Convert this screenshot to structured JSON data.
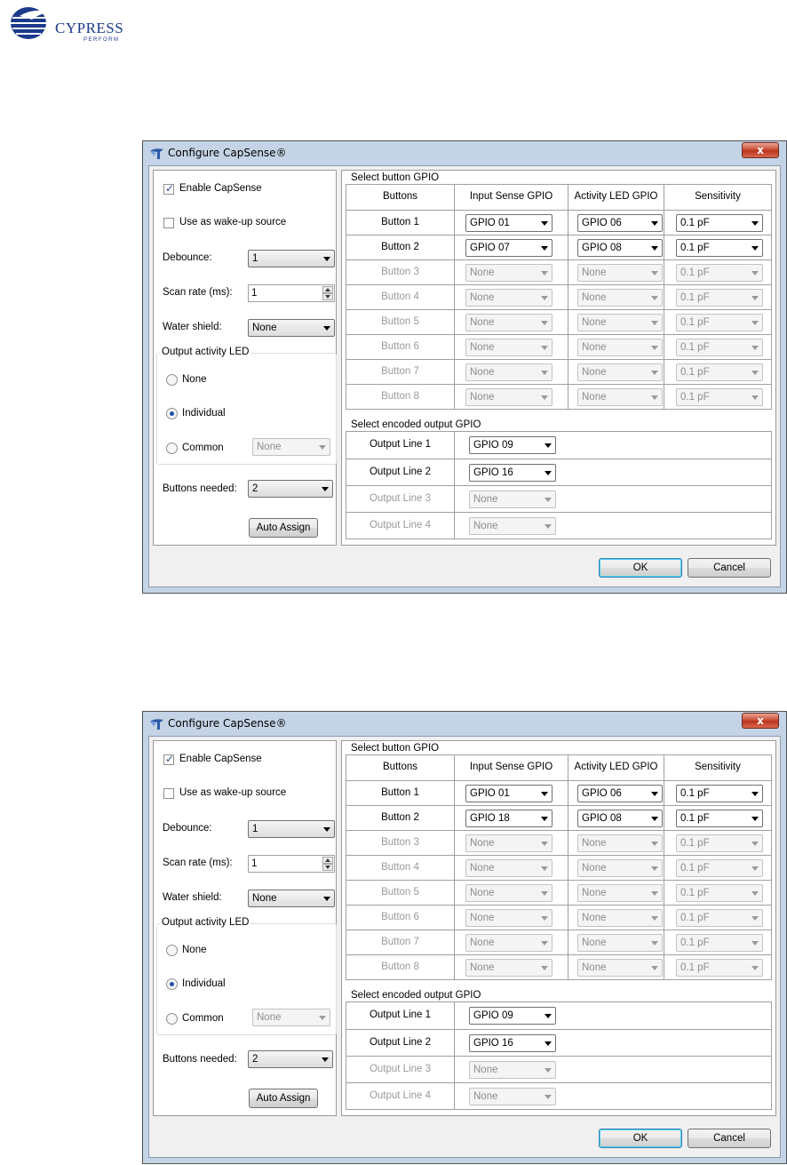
{
  "logo": {
    "name": "CYPRESS",
    "tagline": "PERFORM"
  },
  "dialogs": [
    {
      "title": "Configure CapSense®",
      "close_label": "x",
      "enable_capsense": {
        "label": "Enable CapSense",
        "checked": true
      },
      "wake_up": {
        "label": "Use as wake-up source",
        "checked": false
      },
      "debounce": {
        "label": "Debounce:",
        "value": "1"
      },
      "scan_rate": {
        "label": "Scan rate (ms):",
        "value": "1"
      },
      "water_shield": {
        "label": "Water shield:",
        "value": "None"
      },
      "output_led": {
        "title": "Output activity LED",
        "none_label": "None",
        "individual_label": "Individual",
        "common_label": "Common",
        "common_value": "None",
        "selected": "individual"
      },
      "buttons_needed": {
        "label": "Buttons needed:",
        "value": "2"
      },
      "auto_assign_label": "Auto Assign",
      "button_gpio": {
        "title": "Select button GPIO",
        "headers": [
          "Buttons",
          "Input Sense GPIO",
          "Activity LED GPIO",
          "Sensitivity"
        ],
        "rows": [
          {
            "name": "Button 1",
            "input": "GPIO 01",
            "led": "GPIO 06",
            "sens": "0.1 pF",
            "enabled": true
          },
          {
            "name": "Button 2",
            "input": "GPIO 07",
            "led": "GPIO 08",
            "sens": "0.1 pF",
            "enabled": true
          },
          {
            "name": "Button 3",
            "input": "None",
            "led": "None",
            "sens": "0.1 pF",
            "enabled": false
          },
          {
            "name": "Button 4",
            "input": "None",
            "led": "None",
            "sens": "0.1 pF",
            "enabled": false
          },
          {
            "name": "Button 5",
            "input": "None",
            "led": "None",
            "sens": "0.1 pF",
            "enabled": false
          },
          {
            "name": "Button 6",
            "input": "None",
            "led": "None",
            "sens": "0.1 pF",
            "enabled": false
          },
          {
            "name": "Button 7",
            "input": "None",
            "led": "None",
            "sens": "0.1 pF",
            "enabled": false
          },
          {
            "name": "Button 8",
            "input": "None",
            "led": "None",
            "sens": "0.1 pF",
            "enabled": false
          }
        ]
      },
      "encoded_output": {
        "title": "Select encoded output GPIO",
        "rows": [
          {
            "name": "Output Line 1",
            "value": "GPIO 09",
            "enabled": true
          },
          {
            "name": "Output Line 2",
            "value": "GPIO 16",
            "enabled": true
          },
          {
            "name": "Output Line 3",
            "value": "None",
            "enabled": false
          },
          {
            "name": "Output Line 4",
            "value": "None",
            "enabled": false
          }
        ]
      },
      "ok_label": "OK",
      "cancel_label": "Cancel"
    },
    {
      "title": "Configure CapSense®",
      "close_label": "x",
      "enable_capsense": {
        "label": "Enable CapSense",
        "checked": true
      },
      "wake_up": {
        "label": "Use as wake-up source",
        "checked": false
      },
      "debounce": {
        "label": "Debounce:",
        "value": "1"
      },
      "scan_rate": {
        "label": "Scan rate (ms):",
        "value": "1"
      },
      "water_shield": {
        "label": "Water shield:",
        "value": "None"
      },
      "output_led": {
        "title": "Output activity LED",
        "none_label": "None",
        "individual_label": "Individual",
        "common_label": "Common",
        "common_value": "None",
        "selected": "individual"
      },
      "buttons_needed": {
        "label": "Buttons needed:",
        "value": "2"
      },
      "auto_assign_label": "Auto Assign",
      "button_gpio": {
        "title": "Select button GPIO",
        "headers": [
          "Buttons",
          "Input Sense GPIO",
          "Activity LED GPIO",
          "Sensitivity"
        ],
        "rows": [
          {
            "name": "Button 1",
            "input": "GPIO 01",
            "led": "GPIO 06",
            "sens": "0.1 pF",
            "enabled": true
          },
          {
            "name": "Button 2",
            "input": "GPIO 18",
            "led": "GPIO 08",
            "sens": "0.1 pF",
            "enabled": true
          },
          {
            "name": "Button 3",
            "input": "None",
            "led": "None",
            "sens": "0.1 pF",
            "enabled": false
          },
          {
            "name": "Button 4",
            "input": "None",
            "led": "None",
            "sens": "0.1 pF",
            "enabled": false
          },
          {
            "name": "Button 5",
            "input": "None",
            "led": "None",
            "sens": "0.1 pF",
            "enabled": false
          },
          {
            "name": "Button 6",
            "input": "None",
            "led": "None",
            "sens": "0.1 pF",
            "enabled": false
          },
          {
            "name": "Button 7",
            "input": "None",
            "led": "None",
            "sens": "0.1 pF",
            "enabled": false
          },
          {
            "name": "Button 8",
            "input": "None",
            "led": "None",
            "sens": "0.1 pF",
            "enabled": false
          }
        ]
      },
      "encoded_output": {
        "title": "Select encoded output GPIO",
        "rows": [
          {
            "name": "Output Line 1",
            "value": "GPIO 09",
            "enabled": true
          },
          {
            "name": "Output Line 2",
            "value": "GPIO 16",
            "enabled": true
          },
          {
            "name": "Output Line 3",
            "value": "None",
            "enabled": false
          },
          {
            "name": "Output Line 4",
            "value": "None",
            "enabled": false
          }
        ]
      },
      "ok_label": "OK",
      "cancel_label": "Cancel"
    }
  ]
}
